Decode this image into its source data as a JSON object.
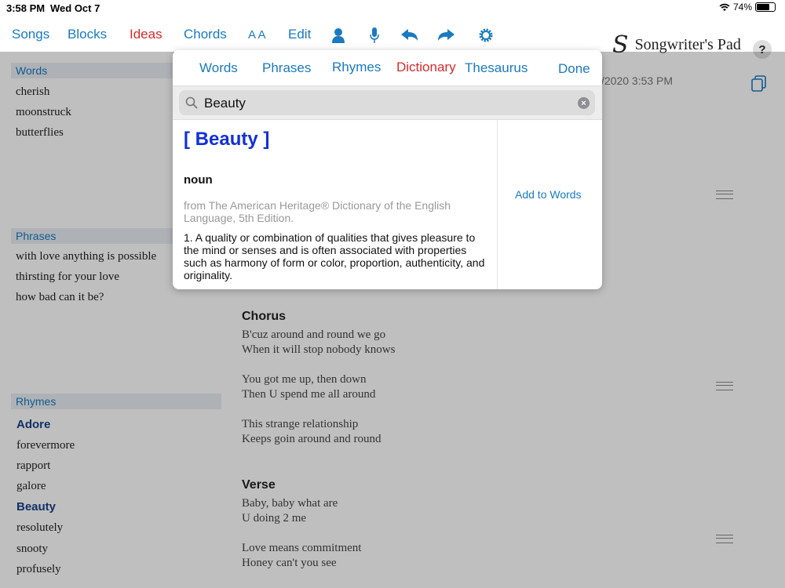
{
  "status": {
    "time": "3:58 PM",
    "date": "Wed Oct 7",
    "battery": "74%",
    "battery_level": 0.74
  },
  "toolbar": {
    "songs": "Songs",
    "blocks": "Blocks",
    "ideas": "Ideas",
    "chords": "Chords",
    "text_size": "A A",
    "edit": "Edit",
    "brand_mark": "S",
    "brand_name": "Songwriter's Pad",
    "help": "?"
  },
  "sidebar": {
    "words_label": "Words",
    "words": [
      "cherish",
      "moonstruck",
      "butterflies"
    ],
    "phrases_label": "Phrases",
    "phrases": [
      "with love anything is possible",
      "thirsting for your love",
      "how bad can it be?"
    ],
    "rhymes_label": "Rhymes",
    "rhymes": [
      "Adore",
      "forevermore",
      "rapport",
      "galore",
      "Beauty",
      "resolutely",
      "snooty",
      "profusely"
    ]
  },
  "song": {
    "date_fragment": "/2020 3:53 PM",
    "chorus_label": "Chorus",
    "chorus_lines": [
      "B'cuz around and round we go",
      "When it will stop nobody knows"
    ],
    "stanza2": [
      "You got me up, then down",
      "Then U spend me all around"
    ],
    "stanza3": [
      "This strange relationship",
      "Keeps goin around and round"
    ],
    "verse_label": "Verse",
    "verse_lines": [
      "Baby, baby what are",
      "U doing 2 me"
    ],
    "stanza5": [
      "Love means commitment",
      "Honey can't you see"
    ]
  },
  "popup": {
    "tabs": [
      "Words",
      "Phrases",
      "Rhymes",
      "Dictionary",
      "Thesaurus"
    ],
    "done": "Done",
    "search_value": "Beauty",
    "headword": "[ Beauty ]",
    "part_of_speech": "noun",
    "source": "from The American Heritage® Dictionary of the English Language, 5th Edition.",
    "definition": "1. A quality or combination of qualities that gives pleasure to the mind or senses and is often associated with properties such as harmony of form or color, proportion, authenticity, and originality.",
    "add_to_words": "Add to Words"
  }
}
